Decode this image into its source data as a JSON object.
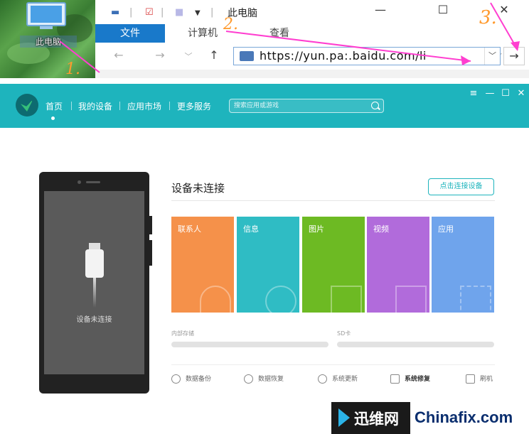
{
  "desktop": {
    "pc_label": "此电脑",
    "step1": "1."
  },
  "explorer": {
    "title": "此电脑",
    "tabs": [
      "文件",
      "计算机",
      "查看"
    ],
    "step2": "2.",
    "step3": "3.",
    "address_url": "https://yun.pa:.baidu.com/li",
    "nav": {
      "back": "←",
      "forward": "→",
      "recent": "﹀",
      "up": "↑",
      "go": "→"
    },
    "window_controls": {
      "minimize": "—",
      "maximize": "☐",
      "close": "✕"
    }
  },
  "app": {
    "nav_items": [
      "首页",
      "我的设备",
      "应用市场",
      "更多服务"
    ],
    "search_placeholder": "搜索应用或游戏",
    "window_controls": {
      "menu": "≡",
      "minimize": "—",
      "maximize": "☐",
      "close": "✕"
    },
    "phone_status": "设备未连接",
    "device_status": "设备未连接",
    "connect_button": "点击连接设备",
    "tiles": [
      {
        "label": "联系人",
        "color": "#f5914a"
      },
      {
        "label": "信息",
        "color": "#2fbcc4"
      },
      {
        "label": "图片",
        "color": "#6dba23"
      },
      {
        "label": "视频",
        "color": "#b16bdb"
      },
      {
        "label": "应用",
        "color": "#6fa4ec"
      }
    ],
    "storage": {
      "internal": "内部存储",
      "sd": "SD卡"
    },
    "tools": [
      "数据备份",
      "数据恢复",
      "系统更新",
      "系统修复",
      "刷机"
    ]
  },
  "watermark": {
    "cn": "迅维网",
    "en": "Chinafix.com"
  },
  "colors": {
    "annotation": "#ff3fd0",
    "step_numbers": "#ff9a2e",
    "header": "#1eb4bd"
  }
}
